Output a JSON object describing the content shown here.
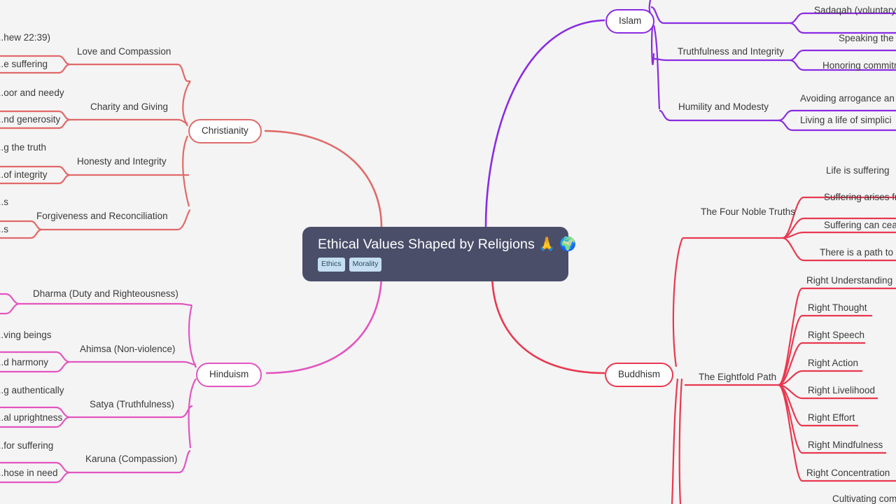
{
  "mindmap": {
    "background_color": "#f4f4f4",
    "root": {
      "title": "Ethical Values Shaped by Religions 🙏 🌍",
      "fill_color": "#4a4e69",
      "tags": [
        "Ethics",
        "Morality"
      ]
    },
    "branches": [
      {
        "id": "christianity",
        "label": "Christianity",
        "color": "#e06a6a",
        "topics": [
          {
            "label": "Love and Compassion",
            "leaves": [
              "...hew 22:39)",
              "...e suffering"
            ]
          },
          {
            "label": "Charity and Giving",
            "leaves": [
              "...oor and needy",
              "...nd generosity"
            ]
          },
          {
            "label": "Honesty and Integrity",
            "leaves": [
              "...g the truth",
              "...of integrity"
            ]
          },
          {
            "label": "Forgiveness and Reconciliation",
            "leaves": [
              "...s",
              "...s"
            ]
          }
        ]
      },
      {
        "id": "islam",
        "label": "Islam",
        "color": "#8a2be2",
        "topics": [
          {
            "label": "",
            "leaves": [
              "Sadaqah (voluntary"
            ]
          },
          {
            "label": "Truthfulness and Integrity",
            "leaves": [
              "Speaking the truth",
              "Honoring commitm"
            ]
          },
          {
            "label": "Humility and Modesty",
            "leaves": [
              "Avoiding arrogance an",
              "Living a life of simplici"
            ]
          }
        ]
      },
      {
        "id": "hinduism",
        "label": "Hinduism",
        "color": "#e255c0",
        "topics": [
          {
            "label": "Dharma (Duty and Righteousness)",
            "leaves": []
          },
          {
            "label": "Ahimsa (Non-violence)",
            "leaves": [
              "...ving beings",
              "...d harmony"
            ]
          },
          {
            "label": "Satya (Truthfulness)",
            "leaves": [
              "...g authentically",
              "...al uprightness"
            ]
          },
          {
            "label": "Karuna (Compassion)",
            "leaves": [
              "...for suffering",
              "...hose in need"
            ]
          }
        ]
      },
      {
        "id": "buddhism",
        "label": "Buddhism",
        "color": "#e8384f",
        "topics": [
          {
            "label": "The Four Noble Truths",
            "leaves": [
              "Life is suffering",
              "Suffering arises fr",
              "Suffering can cea",
              "There is a path to"
            ]
          },
          {
            "label": "The Eightfold Path",
            "leaves": [
              "Right Understanding",
              "Right Thought",
              "Right Speech",
              "Right Action",
              "Right Livelihood",
              "Right Effort",
              "Right Mindfulness",
              "Right Concentration"
            ]
          },
          {
            "label": "",
            "leaves": [
              "Cultivating com"
            ]
          }
        ]
      }
    ]
  }
}
